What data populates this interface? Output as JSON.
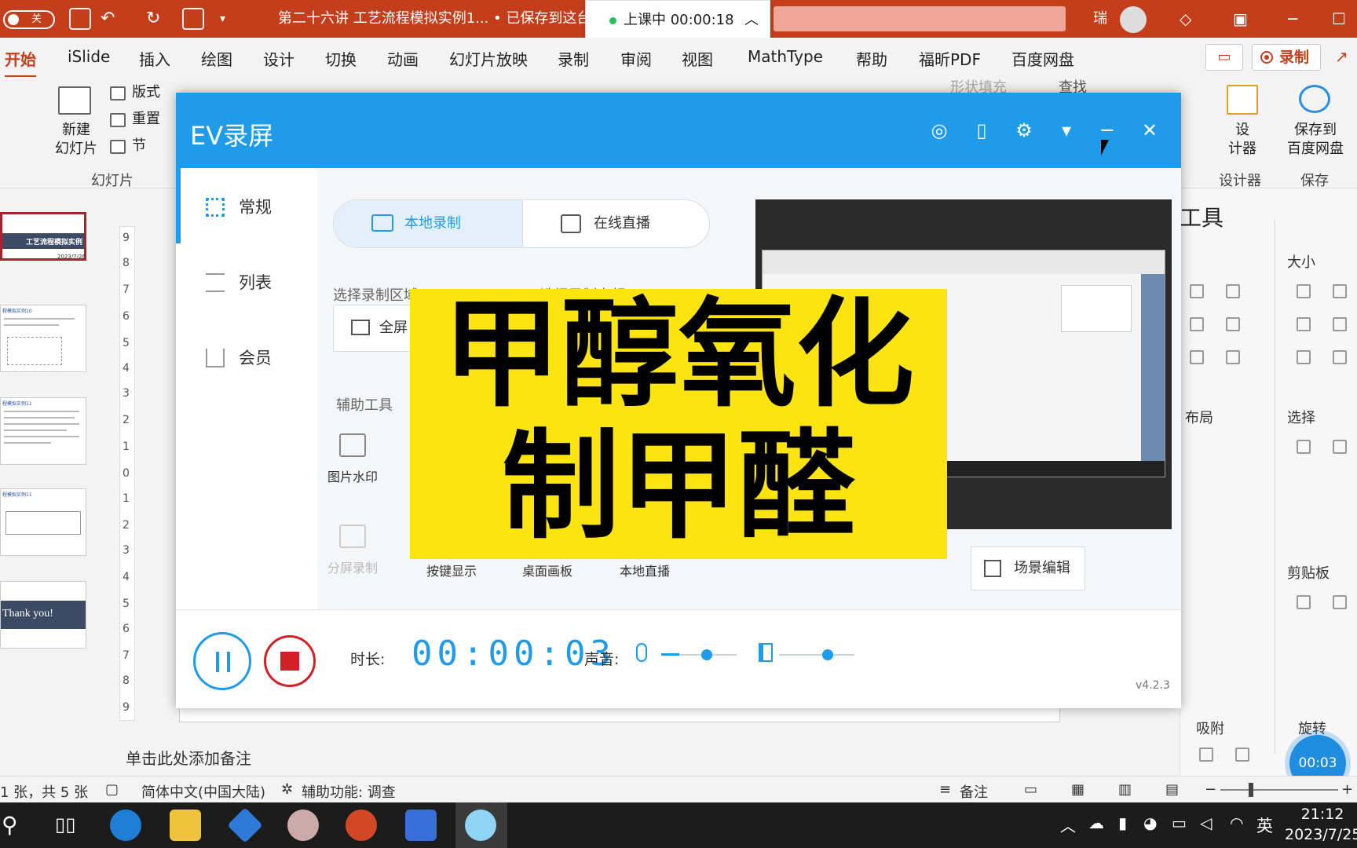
{
  "titlebar": {
    "autosave_label": "关",
    "doc_title": "第二十六讲 工艺流程模拟实例1... • 已保存到这台",
    "user_initial": "瑞",
    "class_status": "上课中 00:00:18"
  },
  "ribbon_tabs": [
    "开始",
    "iSlide",
    "插入",
    "绘图",
    "设计",
    "切换",
    "动画",
    "幻灯片放映",
    "录制",
    "审阅",
    "视图",
    "MathType",
    "帮助",
    "福昕PDF",
    "百度网盘"
  ],
  "ribbon": {
    "new_slide": "新建\n幻灯片",
    "layout": "版式",
    "reset": "重置",
    "section": "节",
    "slides_group": "幻灯片",
    "find": "查找",
    "shape_fill": "形状填充",
    "designer": "设\n计器",
    "designer_group": "设计器",
    "save_baidu": "保存到\n百度网盘",
    "save_group": "保存",
    "record_button": "录制"
  },
  "slides": {
    "thumb1_title": "工艺流程模拟实例",
    "thumb1_date": "2023/7/26",
    "thumb2_title": "程模拟实例10",
    "thumb3_title": "程模拟实例11",
    "thumb4_title": "程模拟实例11",
    "thumb5_title": "Thank you!"
  },
  "ruler_marks": [
    "9",
    "8",
    "7",
    "6",
    "5",
    "4",
    "3",
    "2",
    "1",
    "0",
    "1",
    "2",
    "3",
    "4",
    "5",
    "6",
    "7",
    "8",
    "9"
  ],
  "notes_placeholder": "单击此处添加备注",
  "right_panel": {
    "title": "工具",
    "size": "大小",
    "layout": "布局",
    "select": "选择",
    "clipboard": "剪贴板",
    "snap": "吸附",
    "rotate": "旋转"
  },
  "timer_circle": "00:03",
  "statusbar": {
    "slide_count": "1 张，共 5 张",
    "language": "简体中文(中国大陆)",
    "accessibility": "辅助功能: 调查",
    "notes": "备注"
  },
  "taskbar": {
    "ime": "英",
    "time": "21:12",
    "date": "2023/7/25"
  },
  "ev": {
    "title": "EV录屏",
    "sidebar": [
      "常规",
      "列表",
      "会员"
    ],
    "tab_local": "本地录制",
    "tab_live": "在线直播",
    "select_area": "选择录制区域",
    "select_audio": "选择录制音频",
    "fullscreen": "全屏",
    "aux_tools": "辅助工具",
    "tools": [
      "图片水印",
      "分屏录制",
      "按键显示",
      "桌面画板",
      "本地直播"
    ],
    "scene_edit": "场景编辑",
    "duration_label": "时长:",
    "duration_value": "00:00:03",
    "sound_label": "声音:",
    "version": "v4.2.3",
    "mic_level": 0.6,
    "speaker_level": 0.65
  },
  "overlay": {
    "line1": "甲醇氧化",
    "line2": "制甲醛",
    "bg_color": "#fbe40f"
  },
  "colors": {
    "ppt_accent": "#c43e1c",
    "ev_blue": "#1e9be9",
    "stop_red": "#d32027"
  }
}
